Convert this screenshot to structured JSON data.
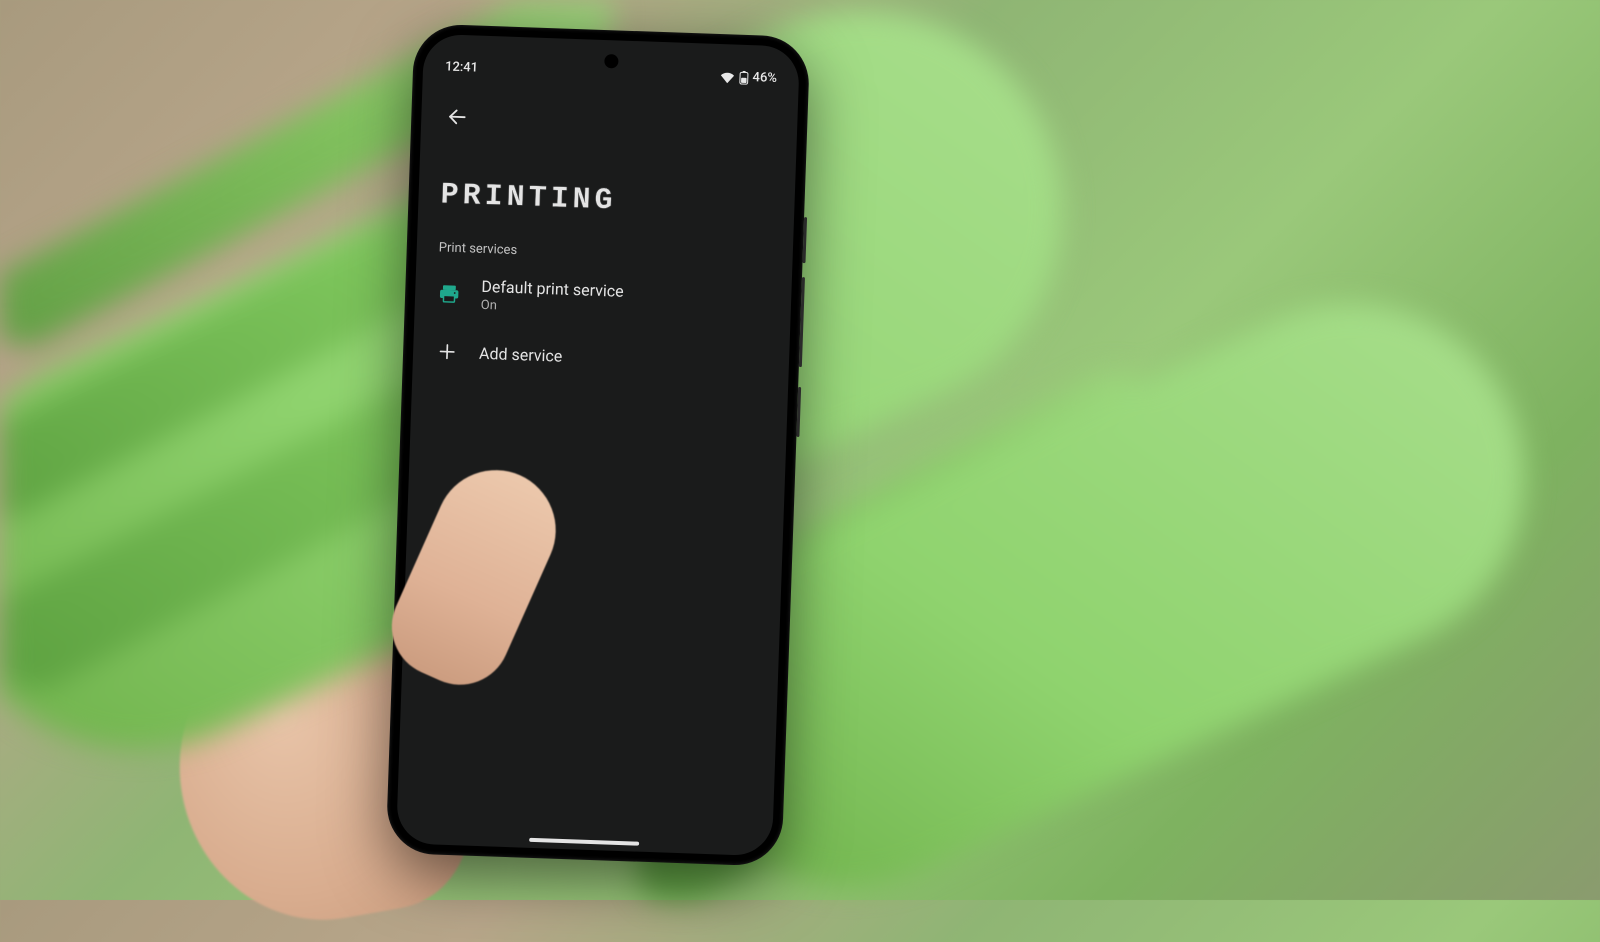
{
  "statusBar": {
    "time": "12:41",
    "batteryText": "46%"
  },
  "page": {
    "title": "PRINTING",
    "sectionLabel": "Print services"
  },
  "items": {
    "defaultService": {
      "title": "Default print service",
      "subtitle": "On"
    },
    "addService": {
      "title": "Add service"
    }
  },
  "colors": {
    "accent": "#1fa88c"
  }
}
